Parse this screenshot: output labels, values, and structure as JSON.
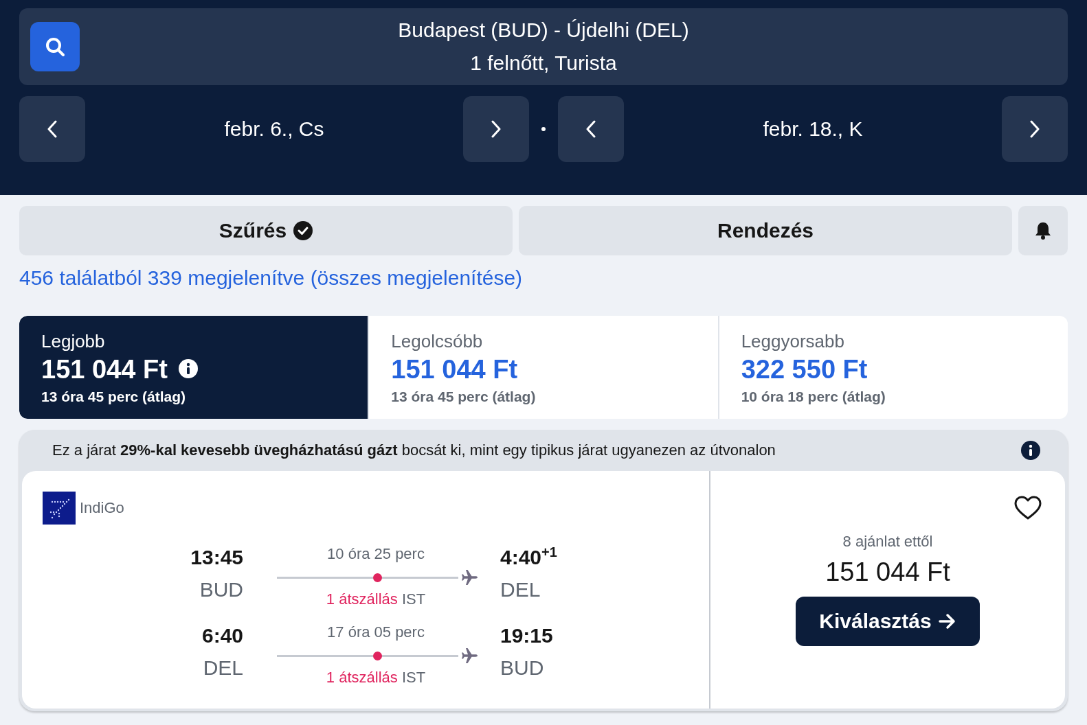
{
  "search": {
    "route": "Budapest (BUD) - Újdelhi (DEL)",
    "passengers": "1 felnőtt, Turista"
  },
  "dates": [
    {
      "label": "febr. 6., Cs"
    },
    {
      "label": "febr. 18., K"
    }
  ],
  "filter_bar": [
    {
      "label": "Szűrés",
      "active": true
    },
    {
      "label": "Rendezés",
      "active": false
    }
  ],
  "results_summary": "456 találatból 339 megjelenítve (összes megjelenítése)",
  "sort_tabs": [
    {
      "label": "Legjobb",
      "price": "151 044 Ft",
      "duration": "13 óra 45 perc (átlag)",
      "selected": true
    },
    {
      "label": "Legolcsóbb",
      "price": "151 044 Ft",
      "duration": "13 óra 45 perc (átlag)",
      "selected": false
    },
    {
      "label": "Leggyorsabb",
      "price": "322 550 Ft",
      "duration": "10 óra 18 perc (átlag)",
      "selected": false
    }
  ],
  "result": {
    "banner": "Ez a járat **29%-kal kevesebb üvegházhatású gázt** bocsát ki, mint egy tipikus járat ugyanezen az útvonalon",
    "airline": "IndiGo",
    "legs": [
      {
        "depart_time": "13:45",
        "depart_airport": "BUD",
        "duration": "10 óra 25 perc",
        "stops": "1 átszállás",
        "via": "IST",
        "arrive_time": "4:40",
        "day_offset": "+1",
        "arrive_airport": "DEL"
      },
      {
        "depart_time": "6:40",
        "depart_airport": "DEL",
        "duration": "17 óra 05 perc",
        "stops": "1 átszállás",
        "via": "IST",
        "arrive_time": "19:15",
        "arrive_airport": "BUD"
      }
    ],
    "offers": "8 ajánlat ettől",
    "price": "151 044 Ft",
    "select_button": "Kiválasztás"
  }
}
